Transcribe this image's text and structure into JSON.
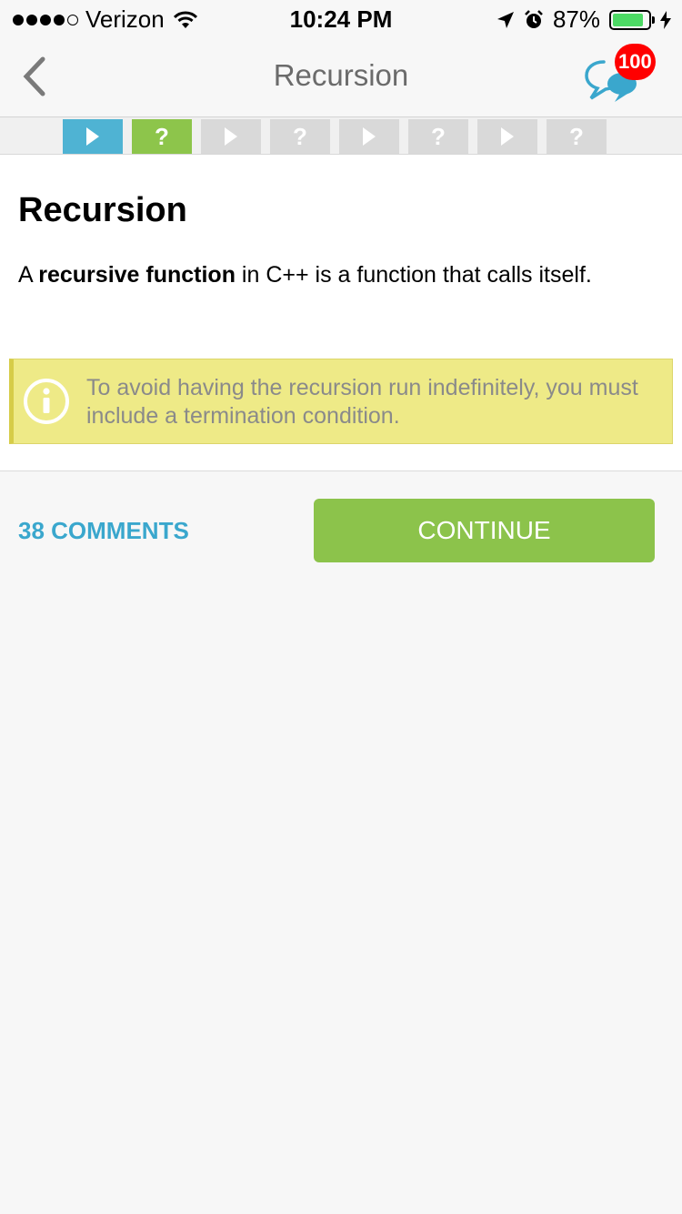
{
  "status_bar": {
    "carrier": "Verizon",
    "time": "10:24 PM",
    "battery": "87%",
    "battery_level": 0.87,
    "signal_bars_filled": 4,
    "signal_bars_total": 5,
    "icons": [
      "wifi-icon",
      "location-arrow-icon",
      "alarm-clock-icon",
      "battery-icon",
      "charging-bolt-icon"
    ]
  },
  "nav": {
    "title": "Recursion",
    "back_icon": "chevron-left-icon",
    "chat_icon": "chat-bubbles-icon",
    "chat_badge": "100",
    "badge_color": "#ff0000",
    "chat_icon_color": "#3aa7cd"
  },
  "progress": {
    "steps": [
      {
        "kind": "lesson",
        "state": "current",
        "icon": "play-icon"
      },
      {
        "kind": "quiz",
        "state": "done",
        "icon": "question-icon",
        "symbol": "?"
      },
      {
        "kind": "lesson",
        "state": "locked",
        "icon": "play-icon"
      },
      {
        "kind": "quiz",
        "state": "locked",
        "icon": "question-icon",
        "symbol": "?"
      },
      {
        "kind": "lesson",
        "state": "locked",
        "icon": "play-icon"
      },
      {
        "kind": "quiz",
        "state": "locked",
        "icon": "question-icon",
        "symbol": "?"
      },
      {
        "kind": "lesson",
        "state": "locked",
        "icon": "play-icon"
      },
      {
        "kind": "quiz",
        "state": "locked",
        "icon": "question-icon",
        "symbol": "?"
      }
    ],
    "colors": {
      "current": "#4fb3d3",
      "done": "#8dc54b",
      "locked": "#d9d9d9"
    }
  },
  "lesson": {
    "title": "Recursion",
    "text_before": "A ",
    "text_bold": "recursive function",
    "text_after": " in C++ is a function that calls itself.",
    "note": "To avoid having the recursion run indefinitely, you must include a termination condition.",
    "note_icon": "info-icon",
    "note_bg": "#eeea87"
  },
  "actions": {
    "comments": "38 COMMENTS",
    "continue": "CONTINUE",
    "accent": "#3aa7cd",
    "continue_bg": "#8cc34b"
  }
}
